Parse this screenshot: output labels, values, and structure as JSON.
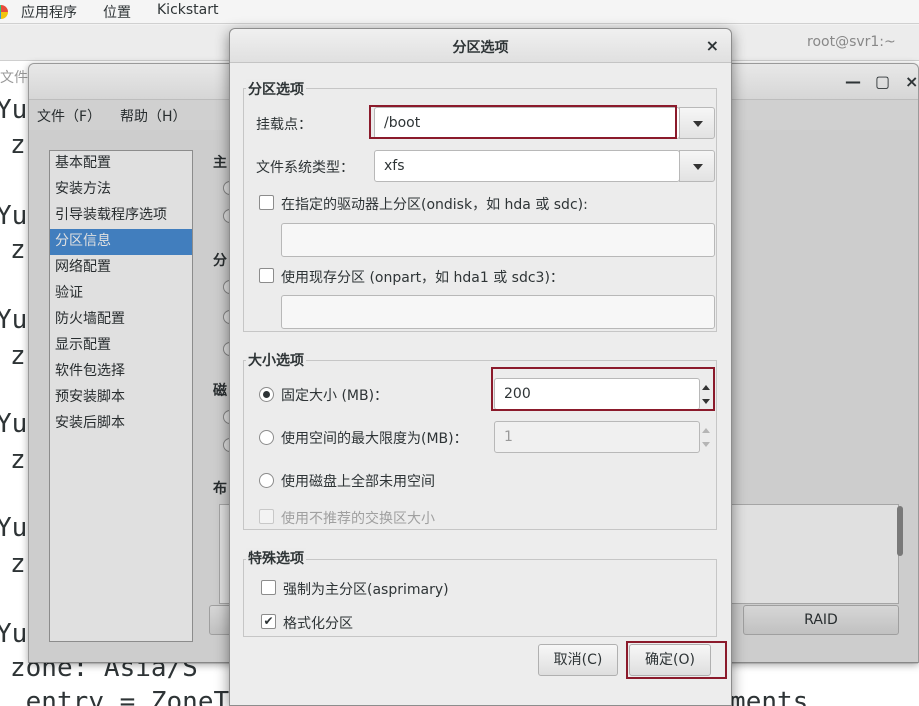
{
  "topbar": {
    "applications": "应用程序",
    "places": "位置",
    "app_name": "Kickstart"
  },
  "terminal": {
    "title": "root@svr1:~",
    "menu_fragment": "文件",
    "lines": [
      "Yu",
      "z",
      "Yu",
      "z",
      "Yu",
      "z",
      "Yu",
      "z",
      "Yu",
      "z",
      "Yu"
    ],
    "bottom_line1": "zone: Asia/S",
    "bottom_line2": " entry = ZoneTabEntry(code, lat, long, tz, comments"
  },
  "kickstart": {
    "window_controls": {
      "minimize": "—",
      "maximize": "▢",
      "close": "×"
    },
    "menu": {
      "file": "文件（F）",
      "help": "帮助（H）"
    },
    "sidebar": [
      {
        "label": "基本配置"
      },
      {
        "label": "安装方法"
      },
      {
        "label": "引导装载程序选项"
      },
      {
        "label": "分区信息",
        "selected": true
      },
      {
        "label": "网络配置"
      },
      {
        "label": "验证"
      },
      {
        "label": "防火墙配置"
      },
      {
        "label": "显示配置"
      },
      {
        "label": "软件包选择"
      },
      {
        "label": "预安装脚本"
      },
      {
        "label": "安装后脚本"
      }
    ],
    "fragments": {
      "f1": "主",
      "f2": "分",
      "f3": "磁",
      "f4": "布"
    },
    "raid_button": "RAID"
  },
  "dialog": {
    "title": "分区选项",
    "close": "×",
    "partition_options": {
      "heading": "分区选项",
      "mount_point_label": "挂载点：",
      "mount_point_value": "/boot",
      "fs_type_label": "文件系统类型：",
      "fs_type_value": "xfs",
      "ondisk_label": "在指定的驱动器上分区(ondisk，如 hda 或 sdc):",
      "ondisk_checked": false,
      "ondisk_value": "",
      "onpart_label": "使用现存分区 (onpart，如 hda1 或 sdc3)：",
      "onpart_checked": false,
      "onpart_value": ""
    },
    "size_options": {
      "heading": "大小选项",
      "fixed_label": "固定大小 (MB)：",
      "fixed_value": "200",
      "fixed_selected": true,
      "max_label": "使用空间的最大限度为(MB)：",
      "max_value": "1",
      "fill_label": "使用磁盘上全部未用空间",
      "swap_label": "使用不推荐的交换区大小"
    },
    "special_options": {
      "heading": "特殊选项",
      "primary_label": "强制为主分区(asprimary)",
      "primary_checked": false,
      "format_label": "格式化分区",
      "format_checked": true
    },
    "buttons": {
      "cancel": "取消(C)",
      "ok": "确定(O)"
    },
    "highlight_color": "#8b1a2b"
  }
}
